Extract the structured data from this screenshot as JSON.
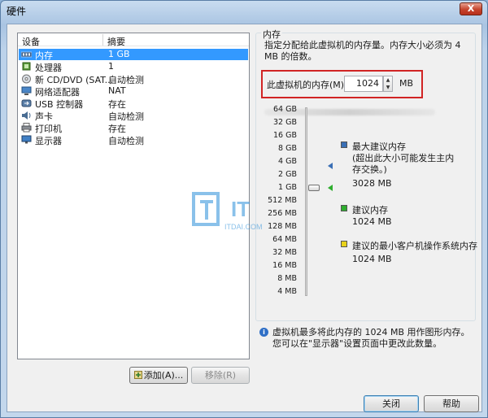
{
  "window": {
    "title": "硬件",
    "close_glyph": "X"
  },
  "devices": {
    "col_device": "设备",
    "col_summary": "摘要",
    "items": [
      {
        "icon": "memory-icon",
        "name": "内存",
        "summary": "1 GB",
        "selected": true
      },
      {
        "icon": "cpu-icon",
        "name": "处理器",
        "summary": "1"
      },
      {
        "icon": "cdrom-icon",
        "name": "新 CD/DVD (SAT...",
        "summary": "自动检测"
      },
      {
        "icon": "network-icon",
        "name": "网络适配器",
        "summary": "NAT"
      },
      {
        "icon": "usb-icon",
        "name": "USB 控制器",
        "summary": "存在"
      },
      {
        "icon": "sound-icon",
        "name": "声卡",
        "summary": "自动检测"
      },
      {
        "icon": "printer-icon",
        "name": "打印机",
        "summary": "存在"
      },
      {
        "icon": "display-icon",
        "name": "显示器",
        "summary": "自动检测"
      }
    ],
    "add_label": "添加(A)...",
    "remove_label": "移除(R)"
  },
  "memory": {
    "group_title": "内存",
    "description": "指定分配给此虚拟机的内存量。内存大小必须为 4 MB 的倍数。",
    "field_label": "此虚拟机的内存(M):",
    "value": "1024",
    "unit": "MB",
    "scale": [
      "64 GB",
      "32 GB",
      "16 GB",
      "8 GB",
      "4 GB",
      "2 GB",
      "1 GB",
      "512 MB",
      "256 MB",
      "128 MB",
      "64 MB",
      "32 MB",
      "16 MB",
      "8 MB",
      "4 MB"
    ],
    "max_recommended": {
      "title": "最大建议内存",
      "note": "(超出此大小可能发生主内存交换。)",
      "value": "3028 MB",
      "color": "#3a6fb5"
    },
    "recommended": {
      "title": "建议内存",
      "value": "1024 MB",
      "color": "#2fae2f"
    },
    "guest_min": {
      "title": "建议的最小客户机操作系统内存",
      "value": "1024 MB",
      "color": "#e8d21a"
    },
    "info": "虚拟机最多将此内存的 1024 MB 用作图形内存。您可以在\"显示器\"设置页面中更改此数量。"
  },
  "buttons": {
    "close": "关闭",
    "help": "帮助"
  },
  "watermark": {
    "brand": "IT",
    "site": "ITDAI.COM"
  }
}
